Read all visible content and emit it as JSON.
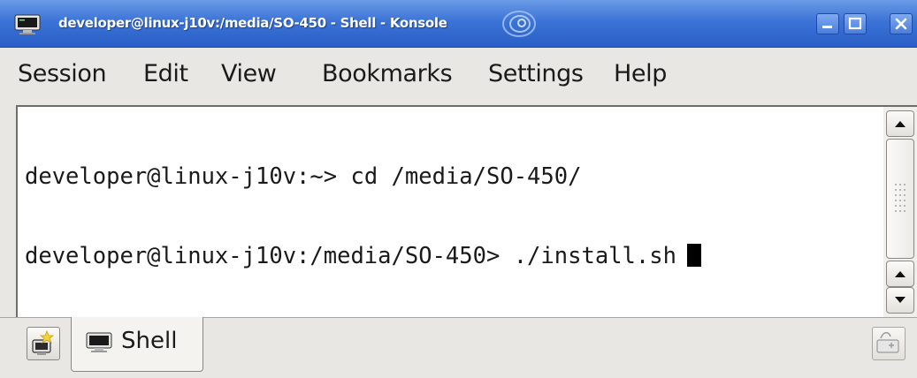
{
  "window": {
    "title": "developer@linux-j10v:/media/SO-450 - Shell - Konsole",
    "icons": {
      "app": "konsole-monitor-icon",
      "swirl": "suse-swirl-icon",
      "minimize": "minimize-icon",
      "maximize": "maximize-icon",
      "close": "close-icon"
    }
  },
  "menubar": {
    "items": [
      {
        "label": "Session"
      },
      {
        "label": "Edit"
      },
      {
        "label": "View"
      },
      {
        "label": "Bookmarks"
      },
      {
        "label": "Settings"
      },
      {
        "label": "Help"
      }
    ]
  },
  "terminal": {
    "lines": [
      {
        "prompt": "developer@linux-j10v:~>",
        "command": "cd /media/SO-450/"
      },
      {
        "prompt": "developer@linux-j10v:/media/SO-450>",
        "command": "./install.sh"
      }
    ]
  },
  "tabbar": {
    "tabs": [
      {
        "label": "Shell",
        "icon": "terminal-icon"
      }
    ],
    "icons": {
      "new_tab": "new-session-icon",
      "close_tab": "close-session-icon"
    }
  },
  "colors": {
    "titlebar": "#3b73d6",
    "terminal_bg": "#ffffff",
    "terminal_fg": "#1a1a1a",
    "chrome": "#e9e7e3"
  }
}
